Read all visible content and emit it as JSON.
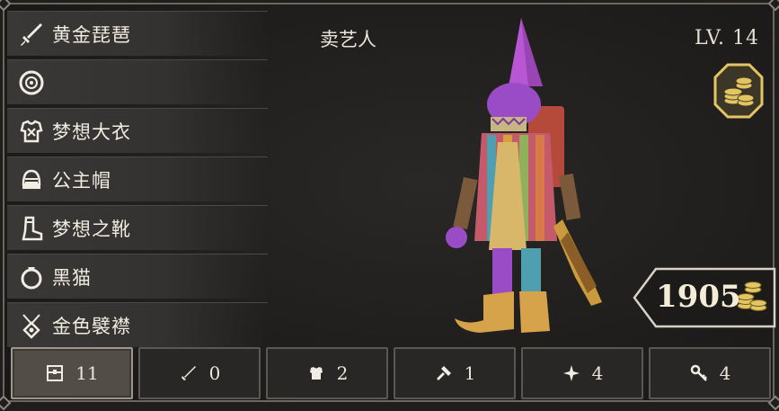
{
  "character": {
    "name": "卖艺人",
    "level": "LV. 14"
  },
  "equipment": [
    {
      "icon": "sword-icon",
      "label": "黄金琵琶"
    },
    {
      "icon": "shield-icon",
      "label": ""
    },
    {
      "icon": "armor-icon",
      "label": "梦想大衣"
    },
    {
      "icon": "helmet-icon",
      "label": "公主帽"
    },
    {
      "icon": "boot-icon",
      "label": "梦想之靴"
    },
    {
      "icon": "ring-icon",
      "label": "黑猫"
    },
    {
      "icon": "amulet-icon",
      "label": "金色襞襟"
    }
  ],
  "gold": {
    "amount": "1905",
    "icon": "coin-stack-icon"
  },
  "tabs": [
    {
      "icon": "chest-icon",
      "count": "11",
      "active": true
    },
    {
      "icon": "sword-icon",
      "count": "0",
      "active": false
    },
    {
      "icon": "armor-icon",
      "count": "2",
      "active": false
    },
    {
      "icon": "hammer-icon",
      "count": "1",
      "active": false
    },
    {
      "icon": "star-icon",
      "count": "4",
      "active": false
    },
    {
      "icon": "key-icon",
      "count": "4",
      "active": false
    }
  ],
  "colors": {
    "accent_gold": "#e3c661",
    "hero_purple": "#a455c8",
    "panel": "#3a3836"
  }
}
